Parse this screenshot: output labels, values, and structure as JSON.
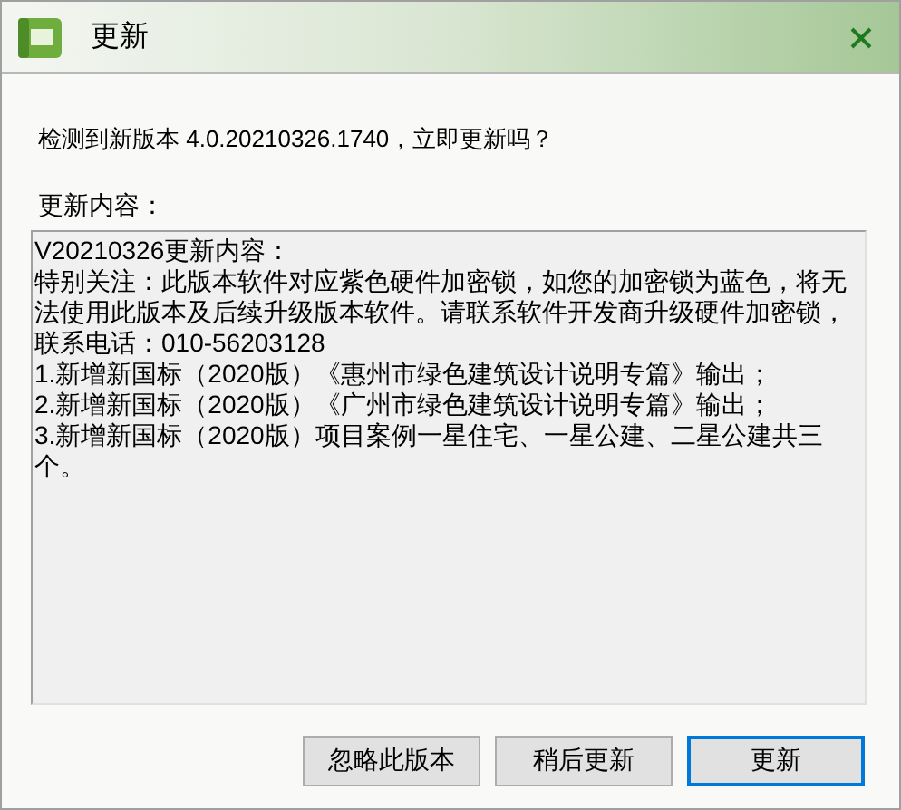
{
  "window": {
    "title": "更新"
  },
  "message": "检测到新版本 4.0.20210326.1740，立即更新吗？",
  "content_label": "更新内容：",
  "content_lines": [
    "V20210326更新内容：",
    "特别关注：此版本软件对应紫色硬件加密锁，如您的加密锁为蓝色，将无",
    "法使用此版本及后续升级版本软件。请联系软件开发商升级硬件加密锁，",
    "联系电话：010-56203128",
    "1.新增新国标（2020版）《惠州市绿色建筑设计说明专篇》输出；",
    "2.新增新国标（2020版）《广州市绿色建筑设计说明专篇》输出；",
    "3.新增新国标（2020版）项目案例一星住宅、一星公建、二星公建共三",
    "个。"
  ],
  "buttons": [
    {
      "label": "忽略此版本",
      "default": false
    },
    {
      "label": "稍后更新",
      "default": false
    },
    {
      "label": "更新",
      "default": true
    }
  ]
}
